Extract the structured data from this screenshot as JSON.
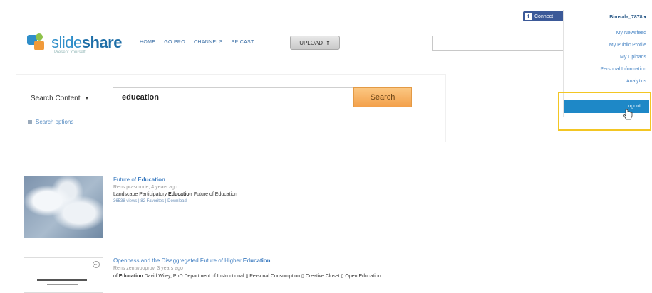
{
  "header": {
    "logo_text_light": "slide",
    "logo_text_bold": "share",
    "logo_tagline": "Present Yourself",
    "nav": [
      "HOME",
      "GO PRO",
      "CHANNELS",
      "SPICAST"
    ],
    "upload_label": "UPLOAD",
    "search_placeholder": "",
    "facebook_label": "Connect"
  },
  "dropdown": {
    "username": "Bimsala_7878",
    "items": [
      "My Newsfeed",
      "My Public Profile",
      "My Uploads",
      "Personal Information",
      "Analytics"
    ],
    "logout_label": "Logout"
  },
  "search": {
    "scope_label": "Search Content",
    "query": "education",
    "button_label": "Search",
    "options_label": "Search options"
  },
  "results": [
    {
      "title_prefix": "Future of ",
      "title_bold": "Education",
      "title_suffix": "",
      "meta": "Rens prasmode, 4 years ago",
      "desc_prefix": "Landscape Participatory ",
      "desc_bold": "Education",
      "desc_suffix": " Future of Education",
      "stats": "36538 views | 82 Favorites | Download"
    },
    {
      "title_prefix": "Openness and the Disaggregated Future of Higher ",
      "title_bold": "Education",
      "title_suffix": "",
      "meta": "Rens zentwooprov, 3 years ago",
      "desc_prefix": "of ",
      "desc_bold": "Education",
      "desc_suffix": " David Wiley, PhD Department of Instructional ▯ Personal Consumption ▯ Creative Closet ▯ Open Education"
    }
  ],
  "colors": {
    "brand_blue": "#2f8ec9",
    "logout_bg": "#1e88c7",
    "highlight": "#f3c623",
    "search_btn": "#f3a04a"
  }
}
